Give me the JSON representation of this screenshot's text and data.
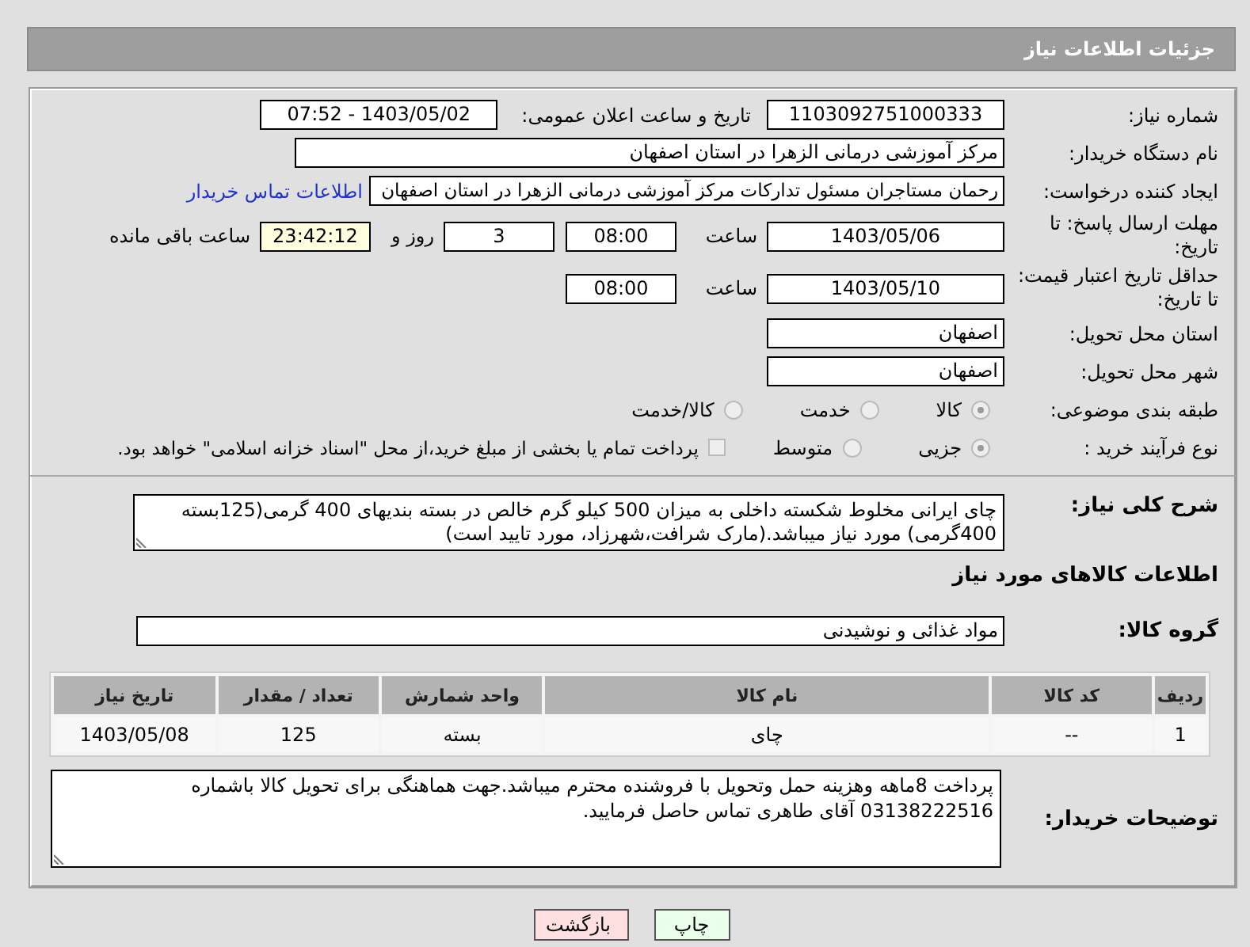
{
  "header": {
    "title": "جزئیات اطلاعات نیاز"
  },
  "need_number": {
    "label": "شماره نیاز:",
    "value": "1103092751000333"
  },
  "announce": {
    "label": "تاریخ و ساعت اعلان عمومی:",
    "value": "1403/05/02 - 07:52"
  },
  "buyer": {
    "label": "نام دستگاه خریدار:",
    "value": "مرکز آموزشی درمانی الزهرا در استان اصفهان"
  },
  "requester": {
    "label": "ایجاد کننده درخواست:",
    "value": "رحمان مستاجران مسئول تدارکات مرکز آموزشی درمانی الزهرا در استان اصفهان",
    "link": "اطلاعات تماس خریدار"
  },
  "deadline": {
    "label": "مهلت ارسال پاسخ: تا تاریخ:",
    "date": "1403/05/06",
    "time_label": "ساعت",
    "time": "08:00",
    "days": "3",
    "days_label": "روز و",
    "remaining": "23:42:12",
    "remaining_label": "ساعت باقی مانده"
  },
  "validity": {
    "label": "حداقل تاریخ اعتبار قیمت: تا تاریخ:",
    "date": "1403/05/10",
    "time_label": "ساعت",
    "time": "08:00"
  },
  "province": {
    "label": "استان محل تحویل:",
    "value": "اصفهان"
  },
  "city": {
    "label": "شهر محل تحویل:",
    "value": "اصفهان"
  },
  "category": {
    "label": "طبقه بندی موضوعی:",
    "options": [
      {
        "label": "کالا",
        "selected": true
      },
      {
        "label": "خدمت",
        "selected": false
      },
      {
        "label": "کالا/خدمت",
        "selected": false
      }
    ]
  },
  "process": {
    "label": "نوع فرآیند خرید :",
    "options": [
      {
        "label": "جزیی",
        "selected": true
      },
      {
        "label": "متوسط",
        "selected": false
      }
    ],
    "treasury": {
      "label": "پرداخت تمام یا بخشی از مبلغ خرید،از محل \"اسناد خزانه اسلامی\" خواهد بود.",
      "checked": false
    }
  },
  "description": {
    "label": "شرح کلی نیاز:",
    "value": "چای ایرانی مخلوط شکسته داخلی به میزان 500 کیلو گرم خالص در بسته بندیهای 400 گرمی(125بسته 400گرمی) مورد نیاز میباشد.(مارک شرافت،شهرزاد، مورد تایید است)"
  },
  "goods_section": {
    "title": "اطلاعات کالاهای مورد نیاز"
  },
  "goods_group": {
    "label": "گروه کالا:",
    "value": "مواد غذائی و نوشیدنی"
  },
  "table": {
    "columns": [
      "ردیف",
      "کد کالا",
      "نام کالا",
      "واحد شمارش",
      "تعداد / مقدار",
      "تاریخ نیاز"
    ],
    "rows": [
      [
        "1",
        "--",
        "چای",
        "بسته",
        "125",
        "1403/05/08"
      ]
    ]
  },
  "buyer_notes": {
    "label": "توضیحات خریدار:",
    "value": "پرداخت 8ماهه وهزینه حمل وتحویل با فروشنده محترم میباشد.جهت هماهنگی برای تحویل کالا باشماره 03138222516 آقای طاهری تماس حاصل فرمایید."
  },
  "buttons": [
    {
      "label": "چاپ",
      "kind": "print"
    },
    {
      "label": "بازگشت",
      "kind": "back"
    }
  ]
}
